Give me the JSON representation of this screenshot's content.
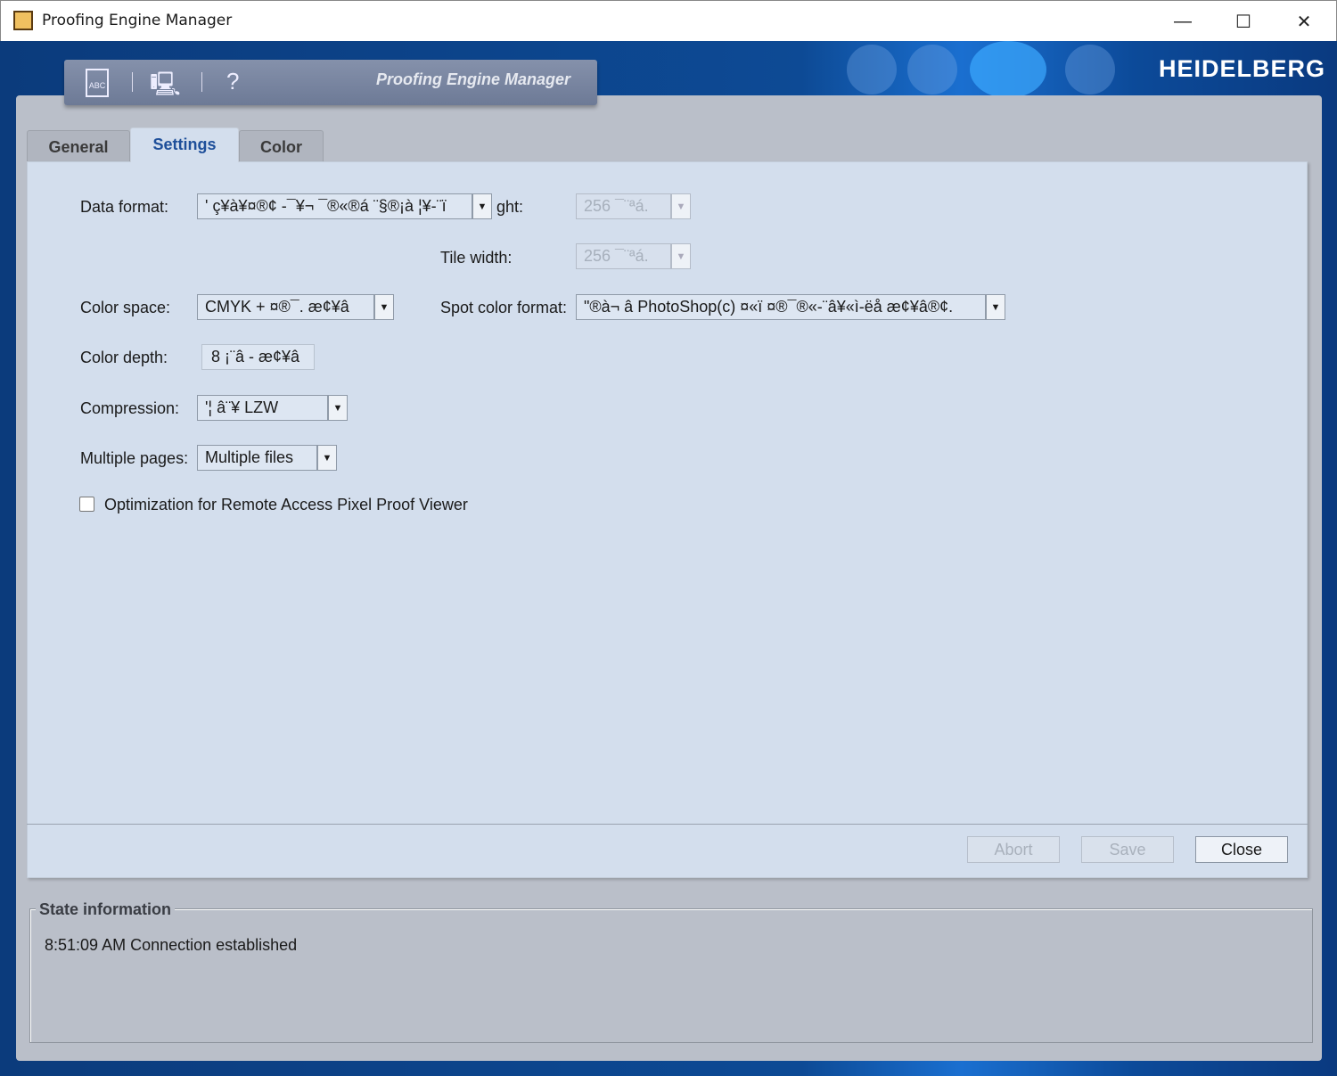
{
  "window": {
    "title": "Proofing Engine Manager",
    "minimize": "—",
    "maximize": "☐",
    "close": "✕"
  },
  "banner": {
    "logo": "HEIDELBERG",
    "toolbar_title": "Proofing Engine Manager",
    "help": "?"
  },
  "tabs": [
    {
      "label": "General"
    },
    {
      "label": "Settings"
    },
    {
      "label": "Color"
    }
  ],
  "settings": {
    "data_format": {
      "label": "Data format:",
      "value": "' ç¥à¥¤®¢ -¯¥¬ ¯®«®á ¨§®¡à ¦¥-¨ï"
    },
    "tile_height": {
      "label": "ght:",
      "value": "256 ¯¨ªá."
    },
    "tile_width": {
      "label": "Tile width:",
      "value": "256 ¯¨ªá."
    },
    "color_space": {
      "label": "Color space:",
      "value": "CMYK + ¤®¯. æ¢¥â"
    },
    "spot_color_format": {
      "label": "Spot color format:",
      "value": "\"®à¬ â PhotoShop(c) ¤«ï ¤®¯®«-¨â¥«ì-ëå æ¢¥â®¢."
    },
    "color_depth": {
      "label": "Color depth:",
      "value": "8 ¡¨â -  æ¢¥â"
    },
    "compression": {
      "label": "Compression:",
      "value": "'¦ â¨¥ LZW"
    },
    "multiple_pages": {
      "label": "Multiple pages:",
      "value": "Multiple files"
    },
    "optimization": {
      "label": "Optimization for Remote Access Pixel Proof Viewer",
      "checked": false
    }
  },
  "buttons": {
    "abort": "Abort",
    "save": "Save",
    "close": "Close"
  },
  "state": {
    "title": "State information",
    "message": "8:51:09 AM Connection established"
  }
}
